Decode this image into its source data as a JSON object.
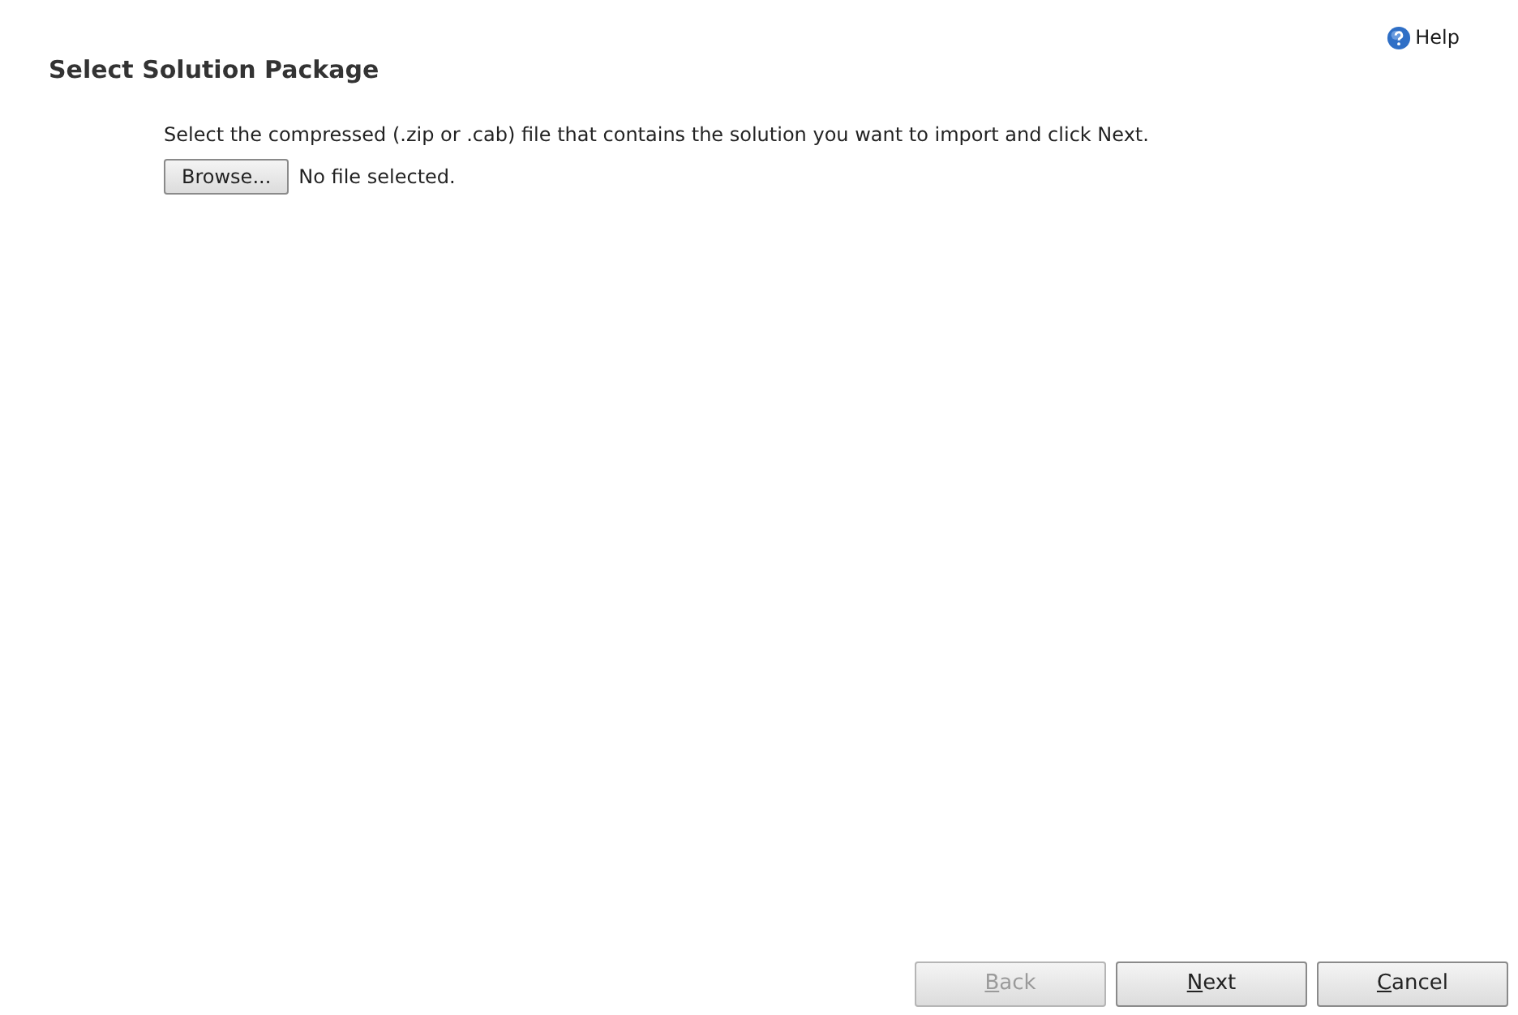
{
  "title": "Select Solution Package",
  "help": {
    "label": "Help"
  },
  "instructions": "Select the compressed (.zip or .cab) file that contains the solution you want to import and click Next.",
  "file_picker": {
    "button": "Browse...",
    "status": "No file selected."
  },
  "buttons": [
    {
      "label": "Back",
      "disabled": true
    },
    {
      "label": "Next",
      "disabled": false
    },
    {
      "label": "Cancel",
      "disabled": false
    }
  ]
}
